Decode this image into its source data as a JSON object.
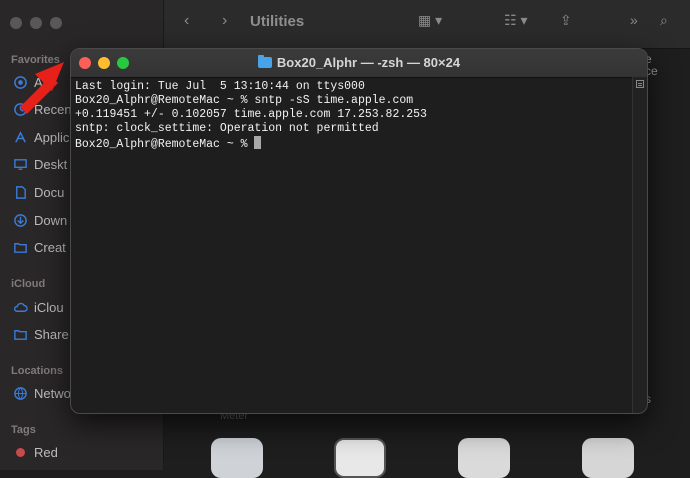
{
  "finder": {
    "title": "Utilities",
    "sidebar": {
      "sections": [
        {
          "heading": "Favorites",
          "items": [
            "Air",
            "Recen",
            "Applic",
            "Deskt",
            "Docu",
            "Down",
            "Creat"
          ]
        },
        {
          "heading": "iCloud",
          "items": [
            "iClou",
            "Share"
          ]
        },
        {
          "heading": "Locations",
          "items": [
            "Netwo"
          ]
        },
        {
          "heading": "Tags",
          "items": [
            "Red"
          ]
        }
      ]
    },
    "content_fragments": {
      "right_top": "e",
      "right_mid": "ce",
      "right_bottom": "s",
      "bottom_label": "Meter"
    }
  },
  "terminal": {
    "title": "Box20_Alphr — -zsh — 80×24",
    "lines": [
      "Last login: Tue Jul  5 13:10:44 on ttys000",
      "Box20_Alphr@RemoteMac ~ % sntp -sS time.apple.com",
      "+0.119451 +/- 0.102057 time.apple.com 17.253.82.253",
      "sntp: clock_settime: Operation not permitted",
      "Box20_Alphr@RemoteMac ~ % "
    ]
  },
  "colors": {
    "close": "#fe5f57",
    "minimize": "#febc2e",
    "maximize": "#28c840",
    "annotation_arrow": "#e8201a",
    "folder_icon": "#48a4e8"
  }
}
